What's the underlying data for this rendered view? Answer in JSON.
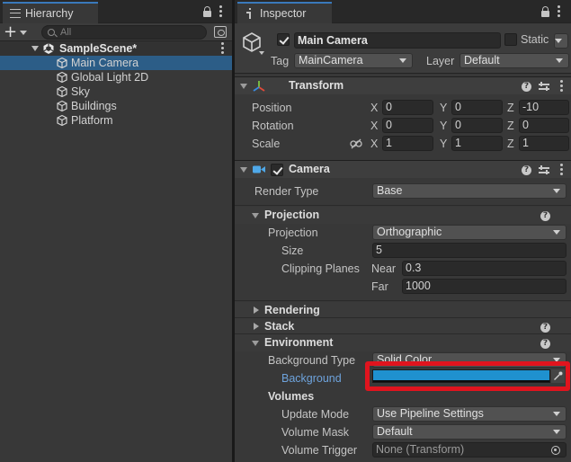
{
  "hierarchy": {
    "tab_label": "Hierarchy",
    "add_button_label": "+",
    "search_placeholder": "All",
    "scene_name": "SampleScene*",
    "items": [
      {
        "label": "Main Camera",
        "selected": true
      },
      {
        "label": "Global Light 2D"
      },
      {
        "label": "Sky"
      },
      {
        "label": "Buildings"
      },
      {
        "label": "Platform"
      }
    ]
  },
  "inspector": {
    "tab_label": "Inspector",
    "object": {
      "name": "Main Camera",
      "static_label": "Static",
      "tag_label": "Tag",
      "tag_value": "MainCamera",
      "layer_label": "Layer",
      "layer_value": "Default"
    },
    "transform": {
      "title": "Transform",
      "position_label": "Position",
      "rotation_label": "Rotation",
      "scale_label": "Scale",
      "axis_x": "X",
      "axis_y": "Y",
      "axis_z": "Z",
      "position": {
        "x": "0",
        "y": "0",
        "z": "-10"
      },
      "rotation": {
        "x": "0",
        "y": "0",
        "z": "0"
      },
      "scale": {
        "x": "1",
        "y": "1",
        "z": "1"
      }
    },
    "camera": {
      "title": "Camera",
      "render_type_label": "Render Type",
      "render_type_value": "Base",
      "projection_title": "Projection",
      "projection_label": "Projection",
      "projection_value": "Orthographic",
      "size_label": "Size",
      "size_value": "5",
      "clipping_label": "Clipping Planes",
      "near_label": "Near",
      "near_value": "0.3",
      "far_label": "Far",
      "far_value": "1000",
      "rendering_title": "Rendering",
      "stack_title": "Stack",
      "environment_title": "Environment",
      "background_type_label": "Background Type",
      "background_type_value": "Solid Color",
      "background_label": "Background",
      "background_color": "#1f91cf",
      "volumes_title": "Volumes",
      "update_mode_label": "Update Mode",
      "update_mode_value": "Use Pipeline Settings",
      "volume_mask_label": "Volume Mask",
      "volume_mask_value": "Default",
      "volume_trigger_label": "Volume Trigger",
      "volume_trigger_value": "None (Transform)"
    }
  },
  "colors": {
    "accent_tab": "#3a79bb",
    "highlight": "#e0141e",
    "selected_row": "#2c5d87",
    "link_label": "#6ea3dc"
  }
}
